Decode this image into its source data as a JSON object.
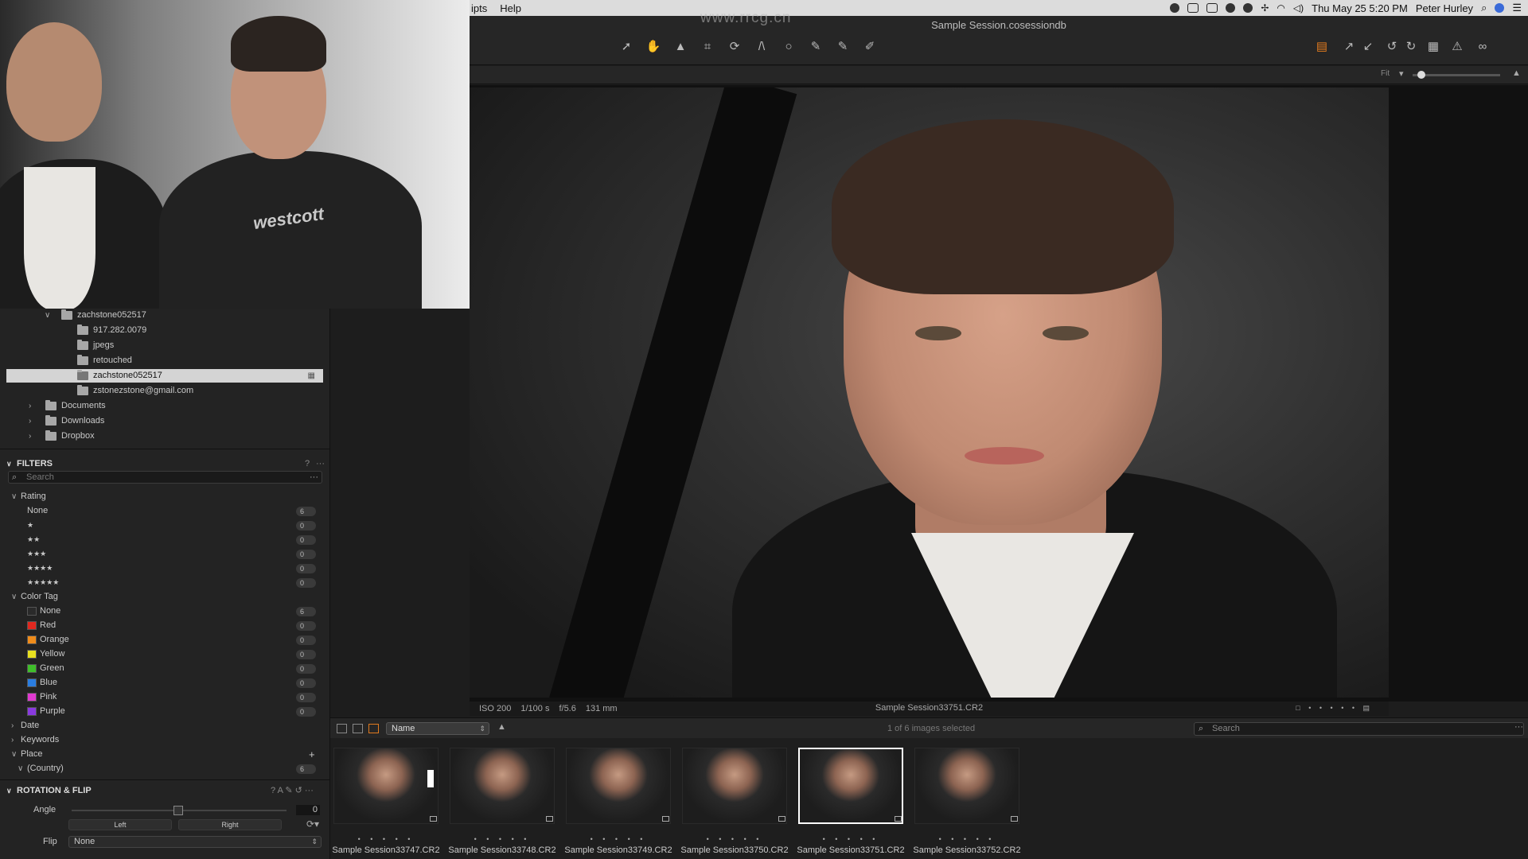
{
  "menubar": {
    "items": [
      "ipts",
      "Help"
    ],
    "clock": "Thu May 25  5:20 PM",
    "user": "Peter Hurley"
  },
  "window": {
    "title": "Sample Session.cosessiondb",
    "watermark": "www.rrcg.cn"
  },
  "video": {
    "shirt_logo": "westcott"
  },
  "library": {
    "folders": [
      {
        "label": "zachstone052517",
        "level": 1,
        "expanded": true
      },
      {
        "label": "917.282.0079",
        "level": 2
      },
      {
        "label": "jpegs",
        "level": 2
      },
      {
        "label": "retouched",
        "level": 2
      },
      {
        "label": "zachstone052517",
        "level": 2,
        "selected": true
      },
      {
        "label": "zstonezstone@gmail.com",
        "level": 2
      },
      {
        "label": "Documents",
        "level": 0,
        "expanded": false
      },
      {
        "label": "Downloads",
        "level": 0,
        "expanded": false
      },
      {
        "label": "Dropbox",
        "level": 0,
        "expanded": false
      }
    ]
  },
  "filters": {
    "title": "FILTERS",
    "help": "?",
    "more": "···",
    "search_placeholder": "Search",
    "rating_label": "Rating",
    "ratings": [
      {
        "label": "None",
        "count": "6"
      },
      {
        "label": "★",
        "count": "0"
      },
      {
        "label": "★★",
        "count": "0"
      },
      {
        "label": "★★★",
        "count": "0"
      },
      {
        "label": "★★★★",
        "count": "0"
      },
      {
        "label": "★★★★★",
        "count": "0"
      }
    ],
    "color_tag_label": "Color Tag",
    "color_tags": [
      {
        "label": "None",
        "count": "6",
        "color": "#2a2a2a"
      },
      {
        "label": "Red",
        "count": "0",
        "color": "#e0281f"
      },
      {
        "label": "Orange",
        "count": "0",
        "color": "#f08c1a"
      },
      {
        "label": "Yellow",
        "count": "0",
        "color": "#e8e01f"
      },
      {
        "label": "Green",
        "count": "0",
        "color": "#3fbf2a"
      },
      {
        "label": "Blue",
        "count": "0",
        "color": "#2a7de0"
      },
      {
        "label": "Pink",
        "count": "0",
        "color": "#e03ad0"
      },
      {
        "label": "Purple",
        "count": "0",
        "color": "#8a3ae0"
      }
    ],
    "date_label": "Date",
    "keywords_label": "Keywords",
    "place_label": "Place",
    "country_label": "(Country)",
    "country_count": "6"
  },
  "rotation": {
    "title": "ROTATION & FLIP",
    "angle_label": "Angle",
    "angle_value": "0",
    "left_label": "Left",
    "right_label": "Right",
    "flip_label": "Flip",
    "flip_value": "None"
  },
  "viewer": {
    "iso": "ISO 200",
    "shutter": "1/100 s",
    "aperture": "f/5.6",
    "focal": "131 mm",
    "filename": "Sample Session33751.CR2",
    "fit_label": "Fit"
  },
  "browser": {
    "sort": "Name",
    "selected_info": "1 of 6 images selected",
    "search_placeholder": "Search"
  },
  "thumbnails": [
    {
      "name": "Sample Session33747.CR2",
      "selected": false
    },
    {
      "name": "Sample Session33748.CR2",
      "selected": false
    },
    {
      "name": "Sample Session33749.CR2",
      "selected": false
    },
    {
      "name": "Sample Session33750.CR2",
      "selected": false
    },
    {
      "name": "Sample Session33751.CR2",
      "selected": true
    },
    {
      "name": "Sample Session33752.CR2",
      "selected": false
    }
  ],
  "colors": {
    "accent": "#e07a1f",
    "selected_row": "#d4d4d4"
  }
}
